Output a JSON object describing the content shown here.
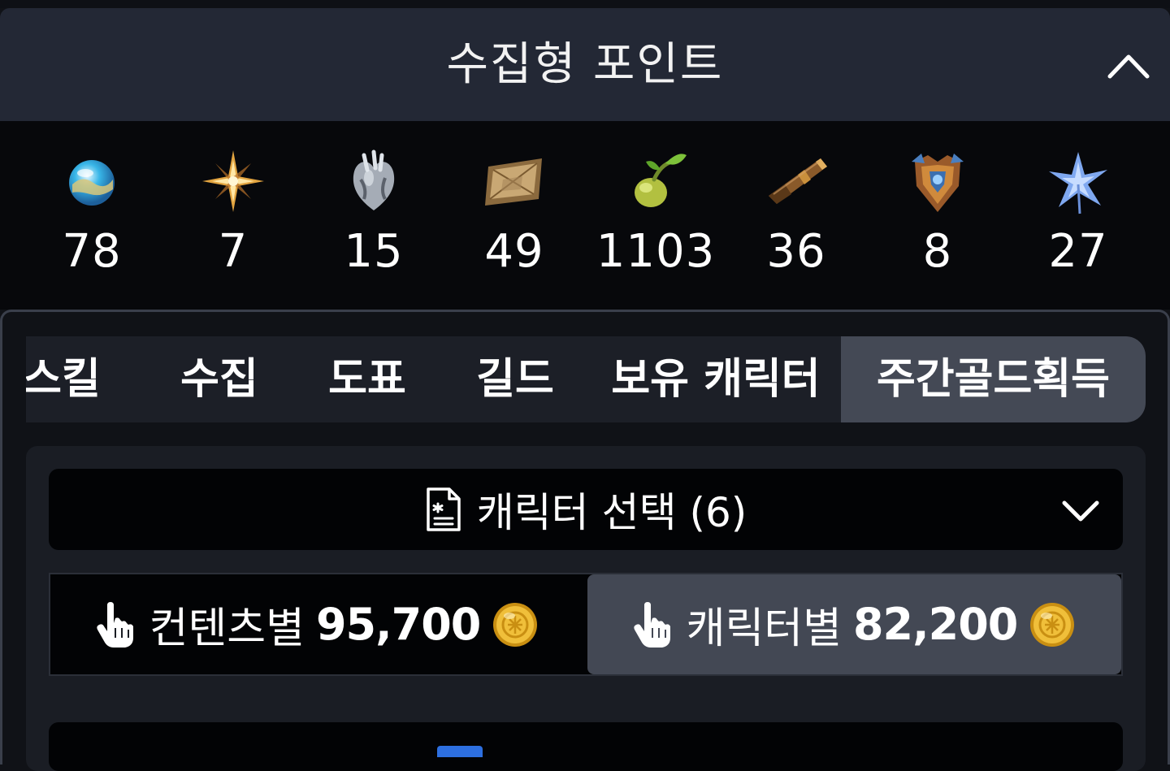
{
  "header": {
    "title": "수집형 포인트"
  },
  "collection": [
    {
      "icon": "island-heart-icon",
      "count": "78"
    },
    {
      "icon": "star-icon",
      "count": "7"
    },
    {
      "icon": "giant-heart-icon",
      "count": "15"
    },
    {
      "icon": "artwork-icon",
      "count": "49"
    },
    {
      "icon": "mokoko-seed-icon",
      "count": "1103"
    },
    {
      "icon": "telescope-icon",
      "count": "36"
    },
    {
      "icon": "ignea-token-icon",
      "count": "8"
    },
    {
      "icon": "world-tree-leaf-icon",
      "count": "27"
    }
  ],
  "tabs": [
    {
      "label": "스킬"
    },
    {
      "label": "수집"
    },
    {
      "label": "도표"
    },
    {
      "label": "길드"
    },
    {
      "label": "보유 캐릭터"
    },
    {
      "label": "주간골드획득",
      "active": true
    }
  ],
  "character_select": {
    "label": "캐릭터 선택 (6)"
  },
  "gold": {
    "by_content": {
      "label": "컨텐츠별",
      "value": "95,700"
    },
    "by_character": {
      "label": "캐릭터별",
      "value": "82,200",
      "active": true
    }
  },
  "colors": {
    "header_bg": "#232835",
    "active_tab": "#444955",
    "gold": "#e6b422",
    "accent_blue": "#2d6fe0"
  }
}
